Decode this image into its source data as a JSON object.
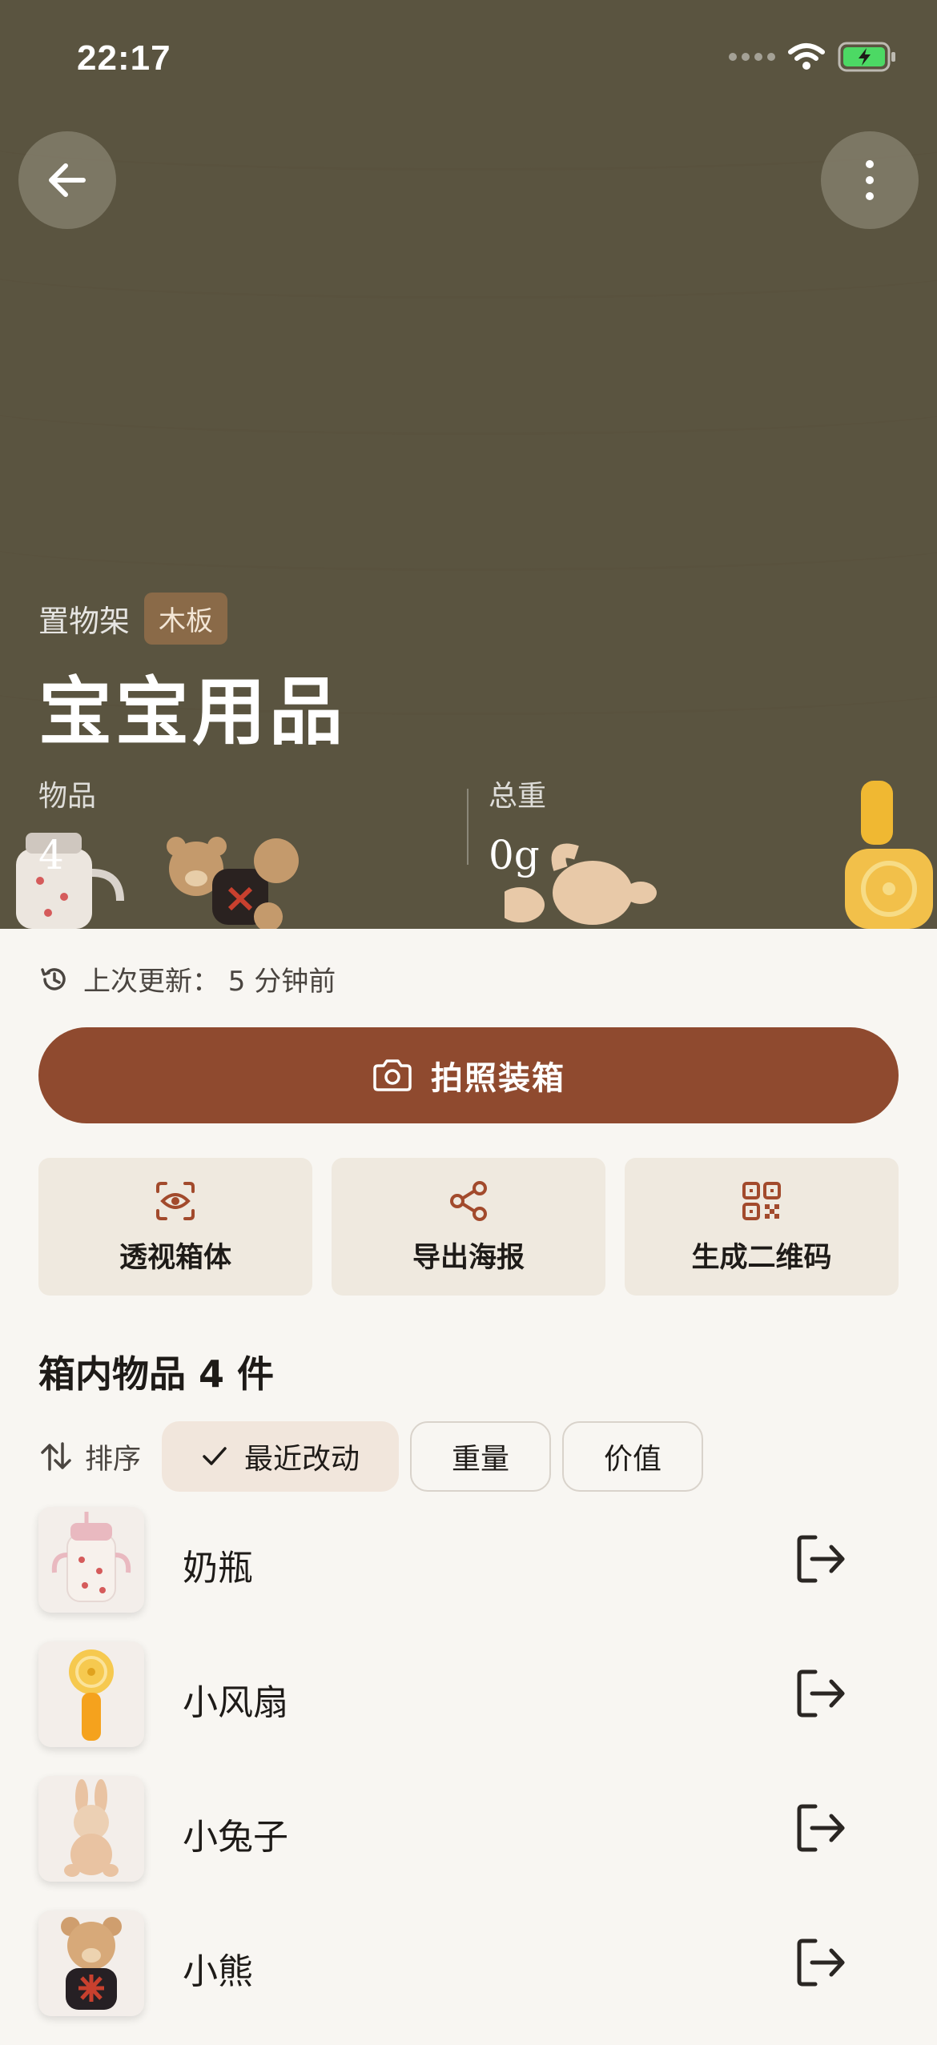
{
  "status_bar": {
    "time": "22:17"
  },
  "hero": {
    "category": "置物架",
    "material_tag": "木板",
    "title": "宝宝用品",
    "stats": [
      {
        "label": "物品",
        "value": "4"
      },
      {
        "label": "总重",
        "value": "0g"
      }
    ]
  },
  "last_updated": "上次更新： 5 分钟前",
  "primary_action": "拍照装箱",
  "actions": [
    {
      "label": "透视箱体",
      "icon": "eye-scan-icon"
    },
    {
      "label": "导出海报",
      "icon": "share-icon"
    },
    {
      "label": "生成二维码",
      "icon": "qr-code-icon"
    }
  ],
  "items_section": {
    "title": "箱内物品 4 件",
    "sort_label": "排序",
    "sort_options": [
      "最近改动",
      "重量",
      "价值"
    ],
    "selected_sort": "最近改动"
  },
  "items": [
    {
      "name": "奶瓶",
      "icon": "baby-bottle-thumb"
    },
    {
      "name": "小风扇",
      "icon": "fan-thumb"
    },
    {
      "name": "小兔子",
      "icon": "bunny-thumb"
    },
    {
      "name": "小熊",
      "icon": "bear-thumb"
    }
  ],
  "colors": {
    "hero_bg": "#5a5440",
    "primary": "#8f4a2f",
    "accent_icon": "#a24a2c",
    "tag_bg": "#8a6a48",
    "page_bg": "#f8f6f2"
  }
}
